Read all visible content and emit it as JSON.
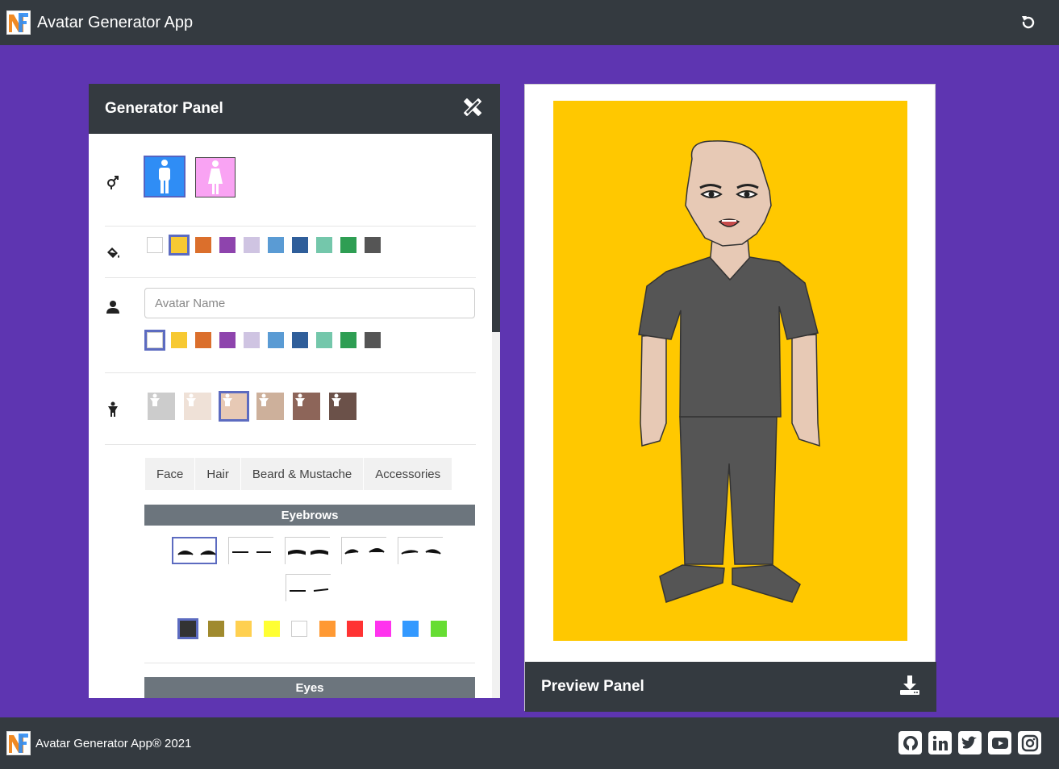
{
  "app": {
    "title": "Avatar Generator App"
  },
  "generator": {
    "title": "Generator Panel",
    "background_colors": [
      "#ffffff",
      "#f7c932",
      "#db6f2c",
      "#8e44ad",
      "#cfc4e2",
      "#5a9bd4",
      "#2f5e9a",
      "#74c7ab",
      "#2e9e53",
      "#555555"
    ],
    "background_selected": 1,
    "name_placeholder": "Avatar Name",
    "name_value": "",
    "name_colors": [
      "#ffffff",
      "#f7c932",
      "#db6f2c",
      "#8e44ad",
      "#cfc4e2",
      "#5a9bd4",
      "#2f5e9a",
      "#74c7ab",
      "#2e9e53",
      "#555555"
    ],
    "name_color_selected": 0,
    "skin_tones": [
      "#cccccc",
      "#efe1d7",
      "#e7c9b5",
      "#cdb09b",
      "#8d6559",
      "#6b5149"
    ],
    "skin_selected": 2,
    "tabs": [
      "Face",
      "Hair",
      "Beard & Mustache",
      "Accessories"
    ],
    "sections": {
      "eyebrows": "Eyebrows",
      "eyes": "Eyes"
    },
    "eyebrow_selected": 0,
    "eyebrow_colors": [
      "#333333",
      "#a08a2e",
      "#ffd050",
      "#ffff33",
      "#ffffff",
      "#ff9933",
      "#ff3333",
      "#ff33ee",
      "#3399ff",
      "#66dd33"
    ],
    "eyebrow_color_selected": 0
  },
  "preview": {
    "title": "Preview Panel",
    "background_color": "#ffc800",
    "skin_color": "#e7c9b5",
    "shirt_color": "#555555",
    "pants_color": "#555555"
  },
  "footer": {
    "text": "Avatar Generator App® 2021",
    "socials": [
      "github-icon",
      "linkedin-icon",
      "twitter-icon",
      "youtube-icon",
      "instagram-icon"
    ]
  }
}
